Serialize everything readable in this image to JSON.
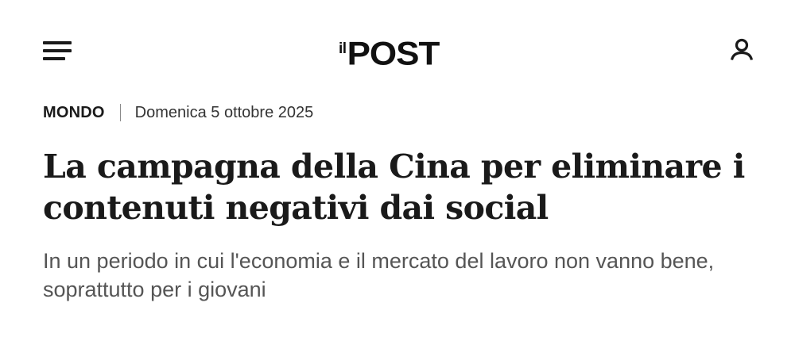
{
  "header": {
    "menu_icon": "hamburger-menu-icon",
    "logo": {
      "prefix": "il",
      "name": "POST"
    },
    "user_icon": "user-account-icon"
  },
  "article": {
    "section": "MONDO",
    "date": "Domenica 5 ottobre 2025",
    "title": "La campagna della Cina per eliminare i contenuti negativi dai social",
    "subtitle": "In un periodo in cui l'economia e il mercato del lavoro non vanno bene, soprattutto per i giovani"
  },
  "colors": {
    "text": "#1a1a1a",
    "subtitle": "#555555",
    "background": "#ffffff"
  }
}
